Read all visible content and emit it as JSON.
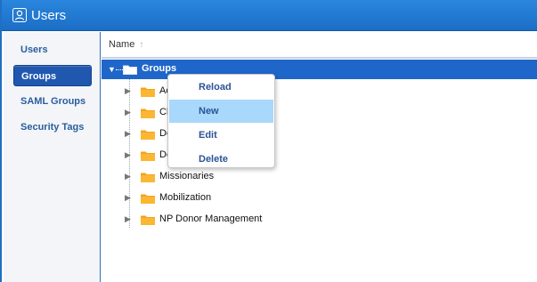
{
  "window": {
    "title": "Users",
    "icon": "users-icon"
  },
  "sidebar": {
    "items": [
      {
        "label": "Users",
        "active": false
      },
      {
        "label": "Groups",
        "active": true
      },
      {
        "label": "SAML Groups",
        "active": false
      },
      {
        "label": "Security Tags",
        "active": false
      }
    ]
  },
  "table": {
    "column_header": "Name",
    "sort_icon": "sort-up-arrow-icon"
  },
  "tree": {
    "root": {
      "label": "Groups",
      "expanded": true,
      "selected": true
    },
    "children": [
      {
        "label": "Ac"
      },
      {
        "label": "Cl"
      },
      {
        "label": "Do"
      },
      {
        "label": "Do"
      },
      {
        "label": "Missionaries"
      },
      {
        "label": "Mobilization"
      },
      {
        "label": "NP Donor Management"
      }
    ]
  },
  "context_menu": {
    "items": [
      {
        "label": "Reload"
      },
      {
        "label": "New"
      },
      {
        "label": "Edit"
      },
      {
        "label": "Delete"
      }
    ],
    "hovered": "New"
  },
  "colors": {
    "titlebar": "#1f78d1",
    "selection": "#1e66c9",
    "menu_hover": "#a8d8fb",
    "folder": "#f7a21b"
  }
}
